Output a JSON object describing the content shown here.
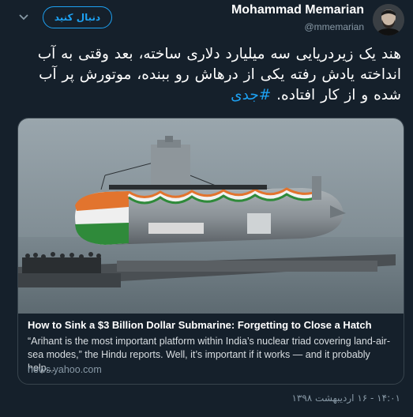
{
  "user": {
    "display_name": "Mohammad Memarian",
    "handle": "@mmemarian"
  },
  "follow_button": {
    "label": "دنبال کنید"
  },
  "menu": {
    "icon": "chevron-down-icon"
  },
  "tweet": {
    "text": "هند یک زیردریایی سه میلیارد دلاری ساخته، بعد وقتی به آب انداخته یادش رفته یکی از درهاش رو ببنده، موتورش پر آب شده و از کار افتاده.",
    "hashtag": "#جدی",
    "timestamp": "۱۴:۰۱ - ۱۶ اردیبهشت ۱۳۹۸"
  },
  "card": {
    "title": "How to Sink a $3 Billion Dollar Submarine: Forgetting to Close a Hatch",
    "description": "“Arihant is the most important platform within India’s nuclear triad covering land-air-sea modes,” the Hindu reports. Well, it’s important if it works — and it probably help...",
    "domain": "news.yahoo.com"
  },
  "colors": {
    "background": "#15202b",
    "accent": "#1da1f2",
    "muted": "#8899a6",
    "border": "#38444d"
  }
}
